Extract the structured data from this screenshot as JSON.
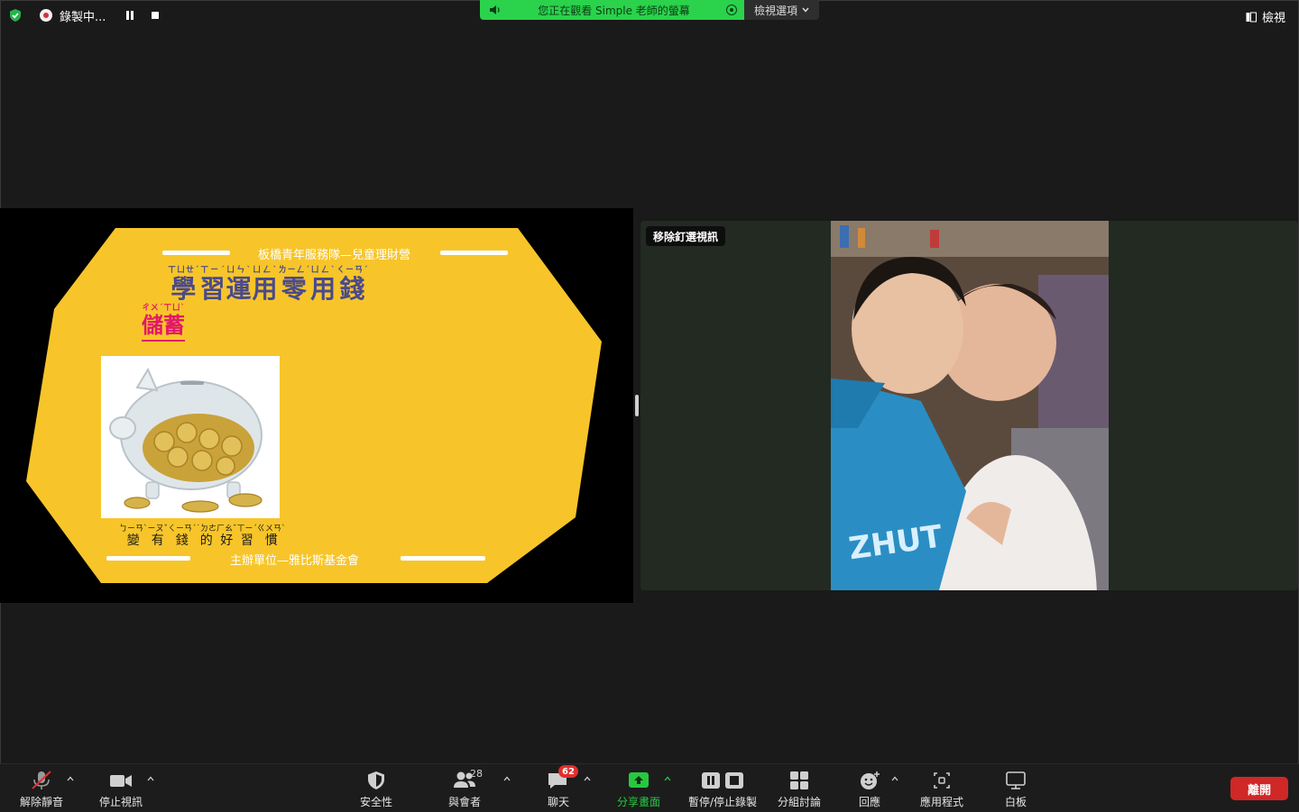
{
  "top_bar": {
    "recording_label": "錄製中...",
    "share_banner_text": "您正在觀看 Simple 老師的螢幕",
    "view_options_label": "檢視選項",
    "view_label": "檢視"
  },
  "slide": {
    "header_org": "板橋青年服務隊—兒童理財營",
    "title": "學習運用零用錢",
    "title_chars": [
      {
        "char": "學",
        "zhuyin": "ㄒㄩㄝˊ"
      },
      {
        "char": "習",
        "zhuyin": "ㄒㄧˊ"
      },
      {
        "char": "運",
        "zhuyin": "ㄩㄣˋ"
      },
      {
        "char": "用",
        "zhuyin": "ㄩㄥˋ"
      },
      {
        "char": "零",
        "zhuyin": "ㄌㄧㄥˊ"
      },
      {
        "char": "用",
        "zhuyin": "ㄩㄥˋ"
      },
      {
        "char": "錢",
        "zhuyin": "ㄑㄧㄢˊ"
      }
    ],
    "subtitle_chars": [
      {
        "char": "儲",
        "zhuyin": "ㄔㄨˊ"
      },
      {
        "char": "蓄",
        "zhuyin": "ㄒㄩˋ"
      }
    ],
    "caption_chars": [
      {
        "char": "變",
        "zhuyin": "ㄅㄧㄢˋ"
      },
      {
        "char": "有",
        "zhuyin": "ㄧㄡˇ"
      },
      {
        "char": "錢",
        "zhuyin": "ㄑㄧㄢˊ"
      },
      {
        "char": "的",
        "zhuyin": "˙ㄉㄜ"
      },
      {
        "char": "好",
        "zhuyin": "ㄏㄠˇ"
      },
      {
        "char": "習",
        "zhuyin": "ㄒㄧˊ"
      },
      {
        "char": "慣",
        "zhuyin": "ㄍㄨㄢˋ"
      }
    ],
    "footer_org": "主辦單位—雅比斯基金會",
    "image_subject": "piggy-bank-with-coins",
    "background_color": "#f7c52a"
  },
  "video": {
    "unpin_label": "移除釘選視訊",
    "image_subject": "two-children-hugging"
  },
  "toolbar": {
    "unmute_label": "解除靜音",
    "stop_video_label": "停止視訊",
    "security_label": "安全性",
    "participants_label": "與會者",
    "participants_count": "28",
    "chat_label": "聊天",
    "chat_badge": "62",
    "share_label": "分享畫面",
    "pause_stop_rec_label": "暫停/停止錄製",
    "breakout_label": "分組討論",
    "reactions_label": "回應",
    "apps_label": "應用程式",
    "whiteboard_label": "白板",
    "leave_label": "離開"
  },
  "colors": {
    "share_banner": "#2bd24b",
    "share_green": "#27c840",
    "leave_red": "#d02727",
    "badge_red": "#e02f2f"
  }
}
